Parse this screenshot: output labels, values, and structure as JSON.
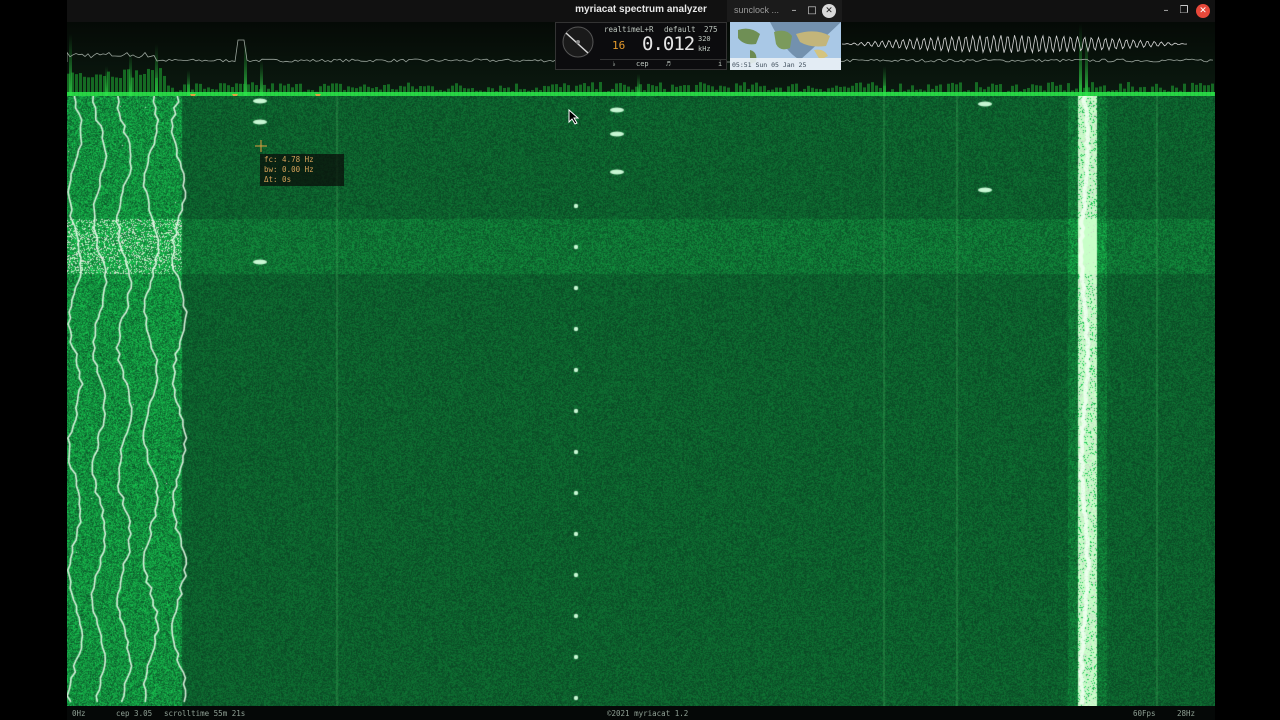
{
  "window": {
    "title": "myriacat spectrum analyzer"
  },
  "sunclock": {
    "title": "sunclock ...",
    "time": "05:51 Sun 05 Jan 25"
  },
  "overlay": {
    "mode": "realtime",
    "channels": "L+R",
    "preset": "default",
    "bins": "275",
    "bits": "16",
    "readout": "0.012",
    "sub_value": "320",
    "unit": "kHz",
    "buttons": [
      "♭",
      "cep",
      "♬",
      "i"
    ]
  },
  "cursor": {
    "frequency": "fc: 4.78 Hz",
    "bandwidth": "bw: 0.00 Hz",
    "delta_time": "Δt: 0s"
  },
  "status": {
    "low_freq": "0Hz",
    "cep": "cep 3.05",
    "scrolltime": "scrolltime 55m 21s",
    "copyright": "©2021 myriacat 1.2",
    "fps": "60Fps",
    "high_freq": "28Hz"
  },
  "colors": {
    "waterfall_base": "#062a17",
    "trace": "#33ff55",
    "marker": "#e0a040",
    "highlight": "#f2fff4"
  }
}
